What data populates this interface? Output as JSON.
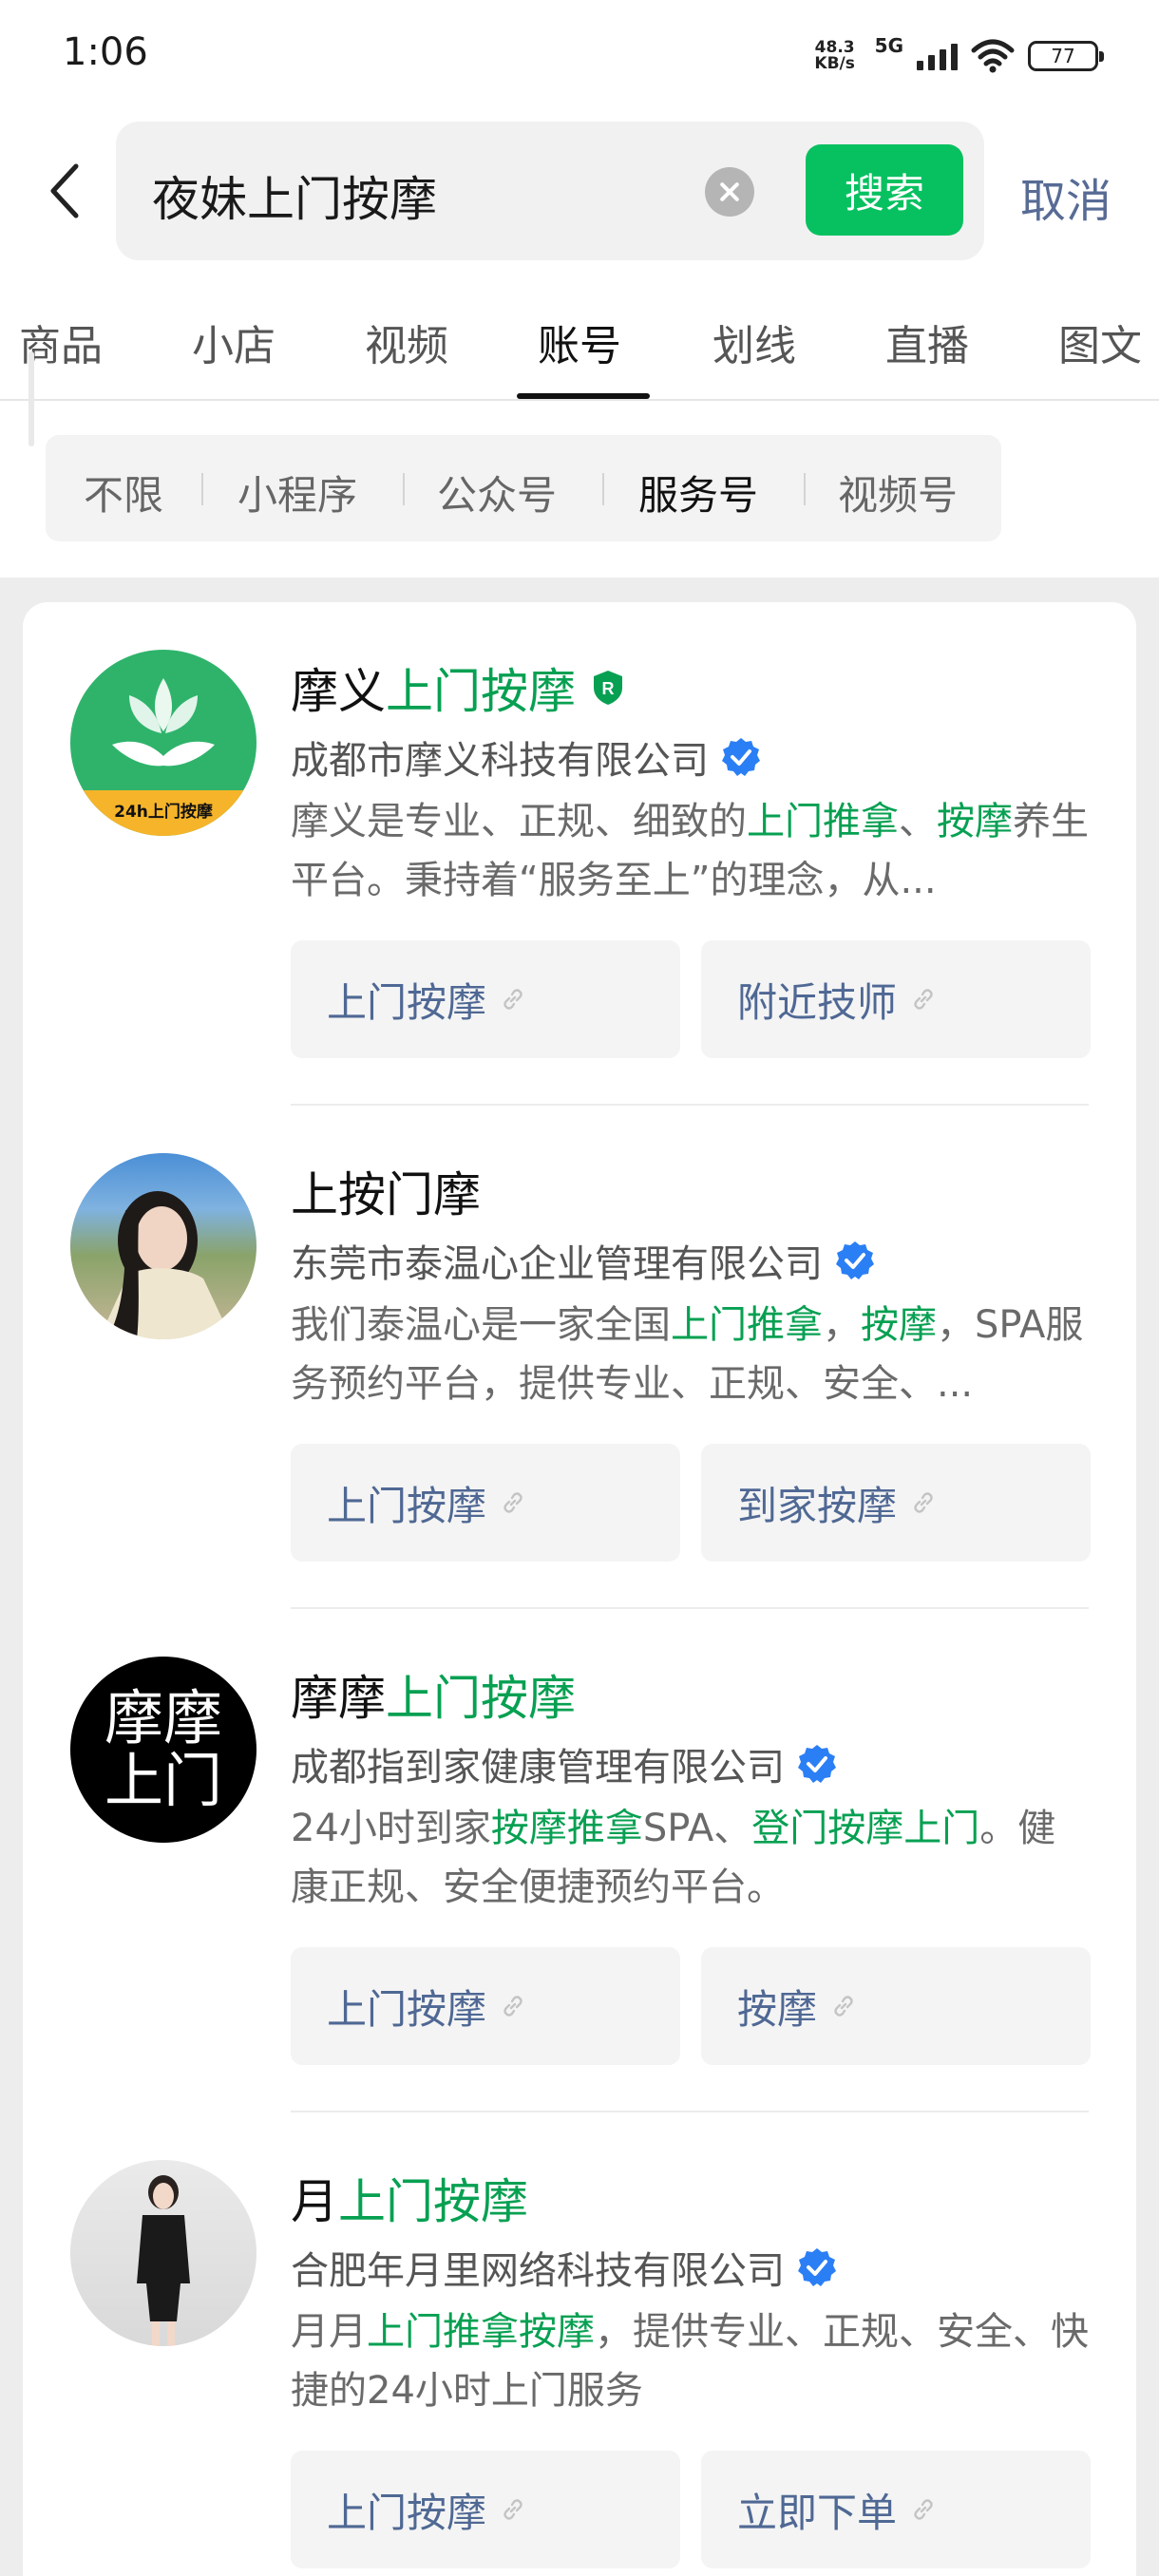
{
  "status_bar": {
    "time": "1:06",
    "net_speed_value": "48.3",
    "net_speed_unit": "KB/s",
    "network": "5G",
    "battery": "77"
  },
  "search": {
    "query": "夜妹上门按摩",
    "search_label": "搜索",
    "cancel_label": "取消"
  },
  "tabs": [
    "商品",
    "小店",
    "视频",
    "账号",
    "划线",
    "直播",
    "图文"
  ],
  "active_tab": "账号",
  "filters": [
    "不限",
    "小程序",
    "公众号",
    "服务号",
    "视频号"
  ],
  "active_filter": "服务号",
  "results": [
    {
      "name_plain": "摩义",
      "name_highlight": "上门按摩",
      "company": "成都市摩义科技有限公司",
      "avatar_text": "24h上门按摩",
      "desc": [
        {
          "t": "摩义是专业、正规、细致的",
          "h": false
        },
        {
          "t": "上门推拿",
          "h": true
        },
        {
          "t": "、",
          "h": false
        },
        {
          "t": "按摩",
          "h": true
        },
        {
          "t": "养生平台。秉持着“服务至上”的理念，从...",
          "h": false
        }
      ],
      "link1": "上门按摩",
      "link2": "附近技师"
    },
    {
      "name_plain": "上按门摩",
      "name_highlight": "",
      "company": "东莞市泰温心企业管理有限公司",
      "desc": [
        {
          "t": "我们泰温心是一家全国",
          "h": false
        },
        {
          "t": "上门推拿",
          "h": true
        },
        {
          "t": "，",
          "h": false
        },
        {
          "t": "按摩",
          "h": true
        },
        {
          "t": "，SPA服务预约平台，提供专业、正规、安全、...",
          "h": false
        }
      ],
      "link1": "上门按摩",
      "link2": "到家按摩"
    },
    {
      "name_plain": "摩摩",
      "name_highlight": "上门按摩",
      "company": "成都指到家健康管理有限公司",
      "avatar_line1": "摩摩",
      "avatar_line2": "上门",
      "desc": [
        {
          "t": "24小时到家",
          "h": false
        },
        {
          "t": "按摩推拿",
          "h": true
        },
        {
          "t": "SPA、",
          "h": false
        },
        {
          "t": "登门按摩上门",
          "h": true
        },
        {
          "t": "。健康正规、安全便捷预约平台。",
          "h": false
        }
      ],
      "link1": "上门按摩",
      "link2": "按摩"
    },
    {
      "name_plain": "月",
      "name_highlight": "上门按摩",
      "company": "合肥年月里网络科技有限公司",
      "desc": [
        {
          "t": "月月",
          "h": false
        },
        {
          "t": "上门推拿按摩",
          "h": true
        },
        {
          "t": "，提供专业、正规、安全、快捷的24小时上门服务",
          "h": false
        }
      ],
      "link1": "上门按摩",
      "link2": "立即下单"
    }
  ],
  "colors": {
    "accent_green": "#07c160",
    "highlight_green": "#07a052",
    "link_blue": "#576b95",
    "verified_blue": "#2b7ff5"
  },
  "icons": {
    "back": "chevron-left-icon",
    "clear": "clear-icon",
    "verified": "verified-badge-icon",
    "registered": "registered-shield-icon",
    "link": "link-icon"
  }
}
